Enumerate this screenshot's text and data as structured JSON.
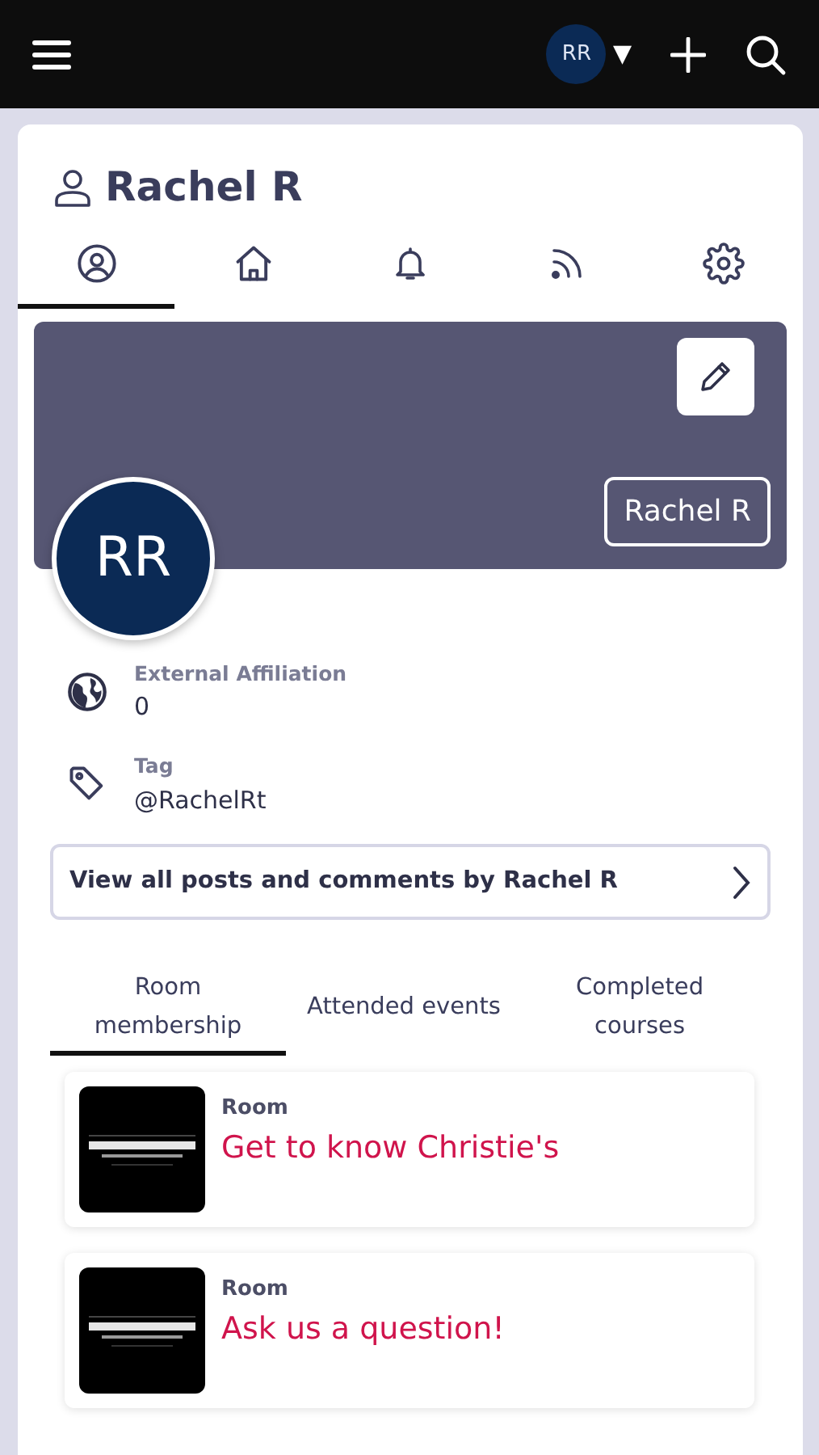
{
  "top_bar": {
    "avatar_initials": "RR",
    "caret": "▼"
  },
  "profile": {
    "name": "Rachel R",
    "banner_name": "Rachel R",
    "avatar_initials": "RR"
  },
  "icon_tabs": [
    {
      "kind": "profile",
      "selected": true
    },
    {
      "kind": "home",
      "selected": false
    },
    {
      "kind": "bell",
      "selected": false
    },
    {
      "kind": "feed",
      "selected": false
    },
    {
      "kind": "settings",
      "selected": false
    }
  ],
  "fields": [
    {
      "kind": "globe",
      "label": "External Affiliation",
      "value": "0"
    },
    {
      "kind": "tag",
      "label": "Tag",
      "value": "@RachelRt"
    }
  ],
  "posts_link": "View all posts and comments by Rachel R",
  "sub_tabs": [
    {
      "label": "Room membership",
      "selected": true
    },
    {
      "label": "Attended events",
      "selected": false
    },
    {
      "label": "Completed courses",
      "selected": false
    }
  ],
  "rooms": [
    {
      "kind": "picture",
      "type": "Room",
      "title": "Get to know Christie's"
    },
    {
      "kind": "picture",
      "type": "Room",
      "title": "Ask us a question!"
    }
  ]
}
